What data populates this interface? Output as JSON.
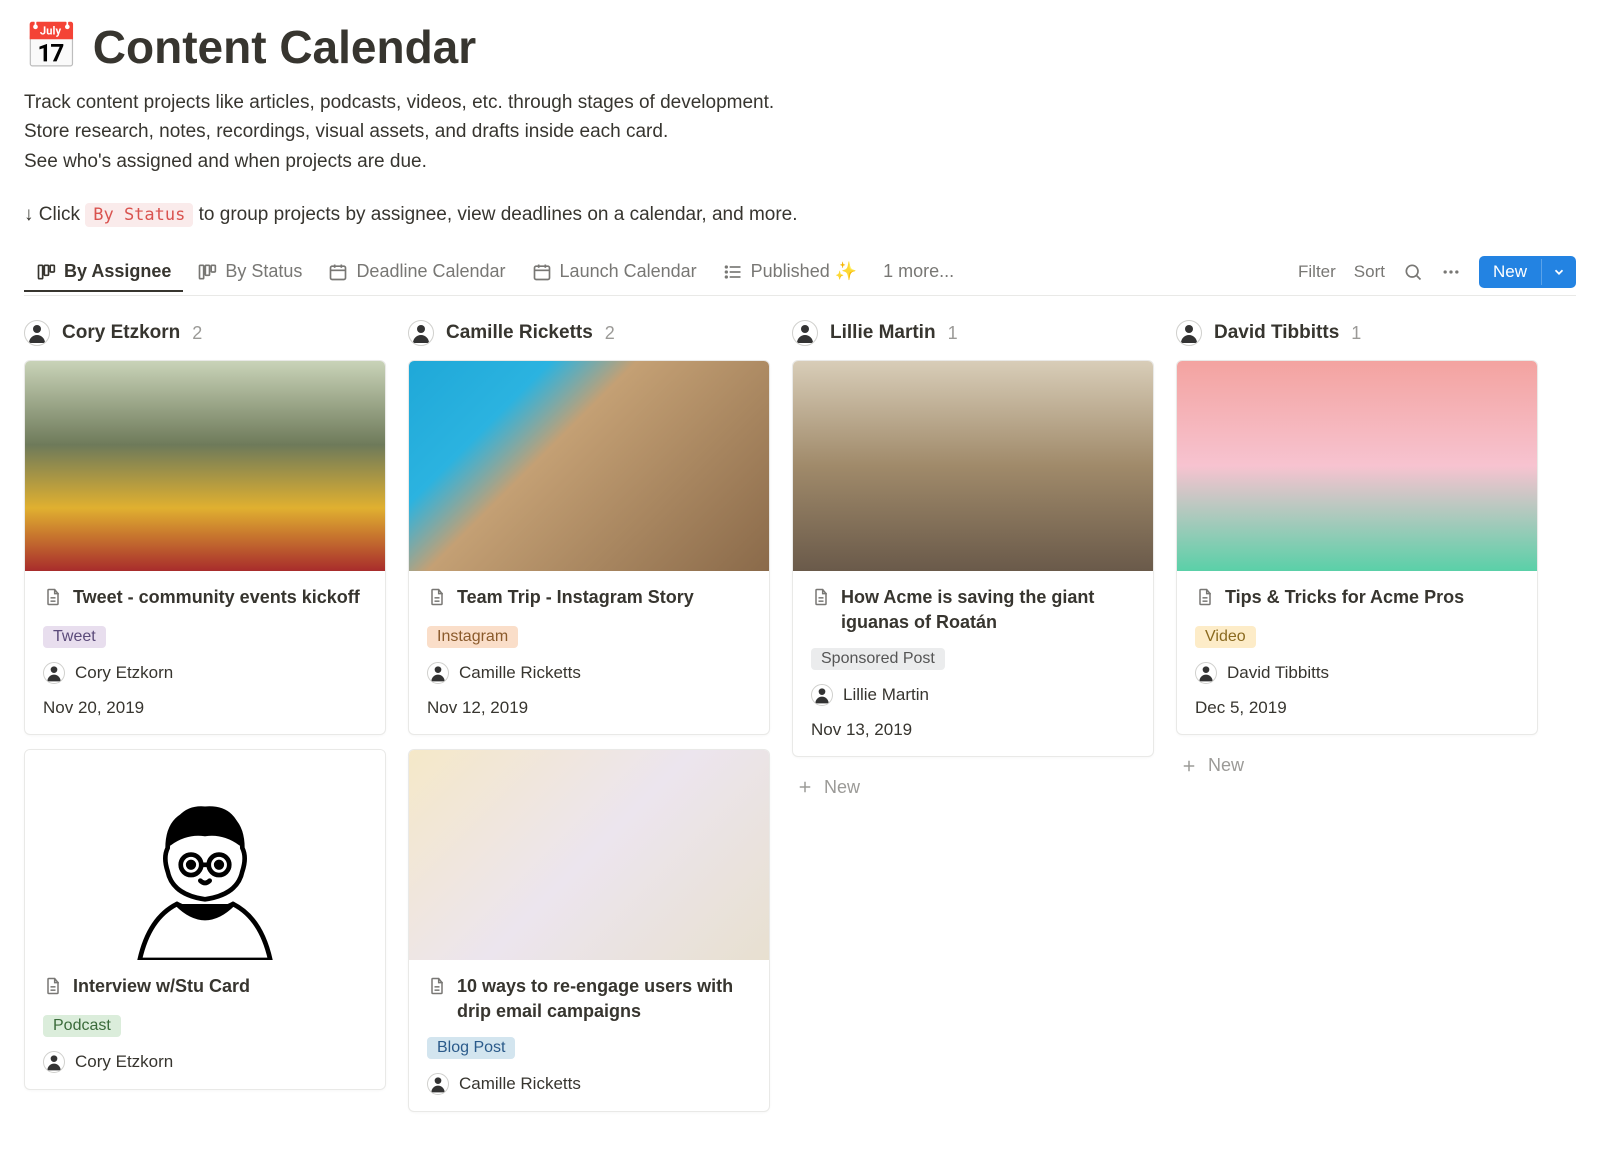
{
  "header": {
    "icon": "calendar-icon",
    "title": "Content Calendar",
    "description": [
      "Track content projects like articles, podcasts, videos, etc. through stages of development.",
      "Store research, notes, recordings, visual assets, and drafts inside each card.",
      "See who's assigned and when projects are due."
    ],
    "hint_prefix": "↓ Click ",
    "hint_code": "By Status",
    "hint_suffix": " to group projects by assignee, view deadlines on a calendar, and more."
  },
  "tabs": [
    {
      "label": "By Assignee",
      "icon": "board-icon",
      "active": true
    },
    {
      "label": "By Status",
      "icon": "board-icon",
      "active": false
    },
    {
      "label": "Deadline Calendar",
      "icon": "calendar-view-icon",
      "active": false
    },
    {
      "label": "Launch Calendar",
      "icon": "calendar-view-icon",
      "active": false
    },
    {
      "label": "Published ✨",
      "icon": "list-icon",
      "active": false
    }
  ],
  "more_tabs_label": "1 more...",
  "toolbar": {
    "filter": "Filter",
    "sort": "Sort",
    "new": "New"
  },
  "columns": [
    {
      "name": "Cory Etzkorn",
      "count": 2,
      "cards": [
        {
          "img": "festival",
          "title": "Tweet - community events kickoff",
          "tag": "Tweet",
          "tag_class": "tag-tweet",
          "assignee": "Cory Etzkorn",
          "date": "Nov 20, 2019"
        },
        {
          "img": "stu",
          "title": "Interview w/Stu Card",
          "tag": "Podcast",
          "tag_class": "tag-podcast",
          "assignee": "Cory Etzkorn",
          "date": ""
        }
      ]
    },
    {
      "name": "Camille Ricketts",
      "count": 2,
      "cards": [
        {
          "img": "building",
          "title": "Team Trip - Instagram Story",
          "tag": "Instagram",
          "tag_class": "tag-instagram",
          "assignee": "Camille Ricketts",
          "date": "Nov 12, 2019"
        },
        {
          "img": "envelopes",
          "title": "10 ways to re-engage users with drip email campaigns",
          "tag": "Blog Post",
          "tag_class": "tag-blog",
          "assignee": "Camille Ricketts",
          "date": ""
        }
      ]
    },
    {
      "name": "Lillie Martin",
      "count": 1,
      "cards": [
        {
          "img": "iguanas",
          "title": "How Acme is saving the giant iguanas of Roatán",
          "tag": "Sponsored Post",
          "tag_class": "tag-sponsored",
          "assignee": "Lillie Martin",
          "date": "Nov 13, 2019"
        }
      ]
    },
    {
      "name": "David Tibbitts",
      "count": 1,
      "cards": [
        {
          "img": "bulb",
          "title": "Tips & Tricks for Acme Pros",
          "tag": "Video",
          "tag_class": "tag-video",
          "assignee": "David Tibbitts",
          "date": "Dec 5, 2019"
        }
      ]
    }
  ],
  "add_new_label": "New"
}
